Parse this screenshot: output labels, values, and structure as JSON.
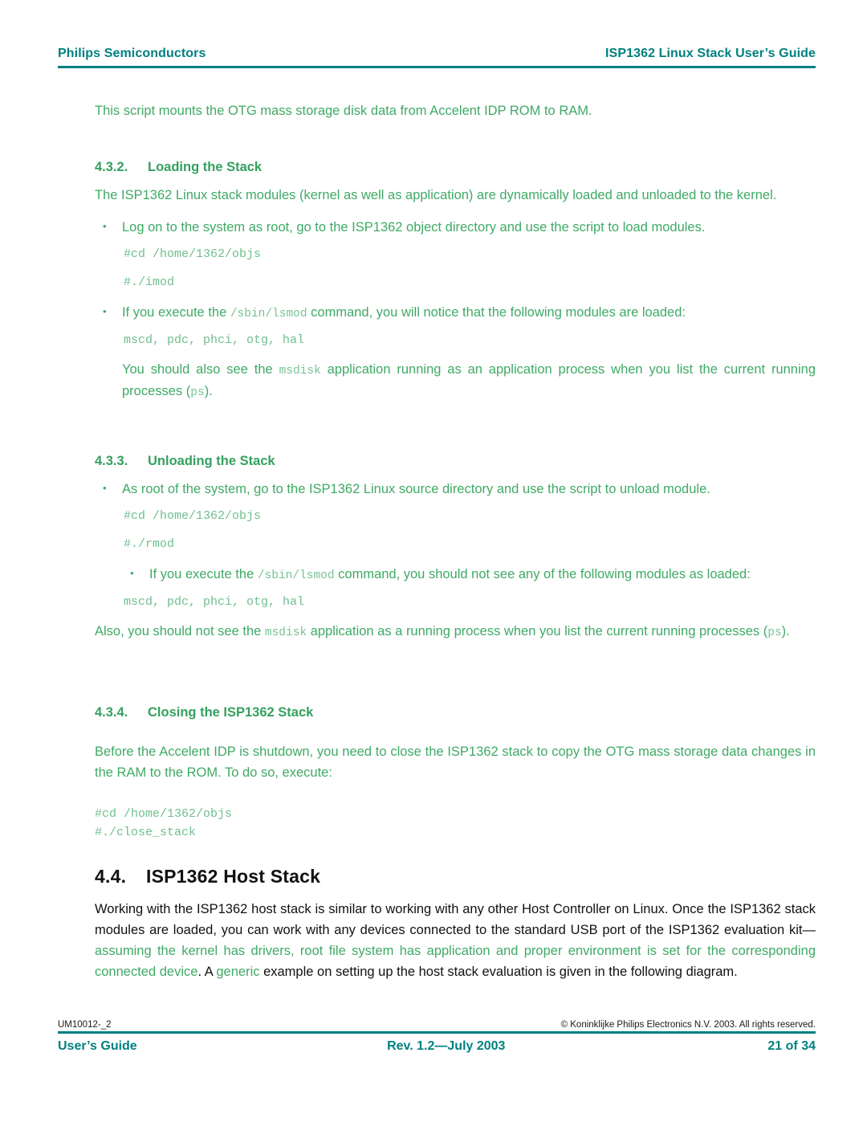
{
  "header": {
    "left": "Philips Semiconductors",
    "right": "ISP1362 Linux Stack User’s Guide",
    "rule_color": "#008080"
  },
  "colors": {
    "teal": "#008080",
    "green_body": "#3faa65",
    "green_heading": "#35a05f",
    "green_code": "#6fbf8e",
    "black": "#111111"
  },
  "body": {
    "intro_para": "This script mounts the OTG mass storage disk data from Accelent IDP ROM to RAM.",
    "section_432": {
      "number": "4.3.2.",
      "title": "Loading the Stack",
      "para": "The ISP1362 Linux stack modules (kernel as well as application) are dynamically loaded and unloaded to the kernel.",
      "bullet1": {
        "marker": "•",
        "text": "Log on to the system as root, go to the ISP1362 object directory and use the script to load modules."
      },
      "code1": "#cd /home/1362/objs",
      "code2": "#./imod",
      "bullet2": {
        "marker": "•",
        "pre": "If you execute the ",
        "code": "/sbin/lsmod",
        "post": " command, you will notice that the following modules are loaded:"
      },
      "code3": "mscd, pdc, phci, otg, hal",
      "para2_a": "You should also see the ",
      "para2_code": "msdisk",
      "para2_b": " application running as an application process when you list the current running processes (",
      "para2_code2": "ps",
      "para2_c": ")."
    },
    "section_433": {
      "number": "4.3.3.",
      "title": "Unloading the Stack",
      "bullet1": {
        "marker": "•",
        "text": "As root of the system, go to the ISP1362 Linux source directory and use the script to unload module."
      },
      "code1": "#cd /home/1362/objs",
      "code2": "#./rmod",
      "bullet2": {
        "marker": "•",
        "pre": "If you execute the ",
        "code": "/sbin/lsmod",
        "post": " command, you should not see any of the following modules as loaded:"
      },
      "code3": "mscd, pdc, phci, otg, hal",
      "para_a": "Also, you should not see the ",
      "para_code": "msdisk",
      "para_b": " application as a running process when you list the current running processes (",
      "para_code2": "ps",
      "para_c": ")."
    },
    "section_434": {
      "number": "4.3.4.",
      "title": "Closing the ISP1362 Stack",
      "para": "Before the Accelent IDP is shutdown, you need to close the ISP1362 stack to copy the OTG mass storage data changes in the RAM to the ROM. To do so, execute:",
      "code1": "#cd /home/1362/objs",
      "code2": "#./close_stack"
    },
    "section_44": {
      "number": "4.4.",
      "title": "ISP1362 Host Stack",
      "para_black1": "Working with the ISP1362 host stack is similar to working with any other Host Controller on Linux. Once the ISP1362 stack modules are loaded, you can work with any devices connected to the standard USB port of the ISP1362 evaluation kit—",
      "para_green1": "assuming the kernel has drivers, root file system has application and proper environment is set for the corresponding connected device",
      "para_black2": ". A ",
      "para_green2": "generic",
      "para_black3": " example on setting up the host stack evaluation is given in the following diagram."
    }
  },
  "footer": {
    "doc_id": "UM10012-_2",
    "copyright": "© Koninklijke Philips Electronics N.V. 2003. All rights reserved.",
    "left": "User’s Guide",
    "center": "Rev. 1.2—July 2003",
    "right": "21 of 34"
  }
}
